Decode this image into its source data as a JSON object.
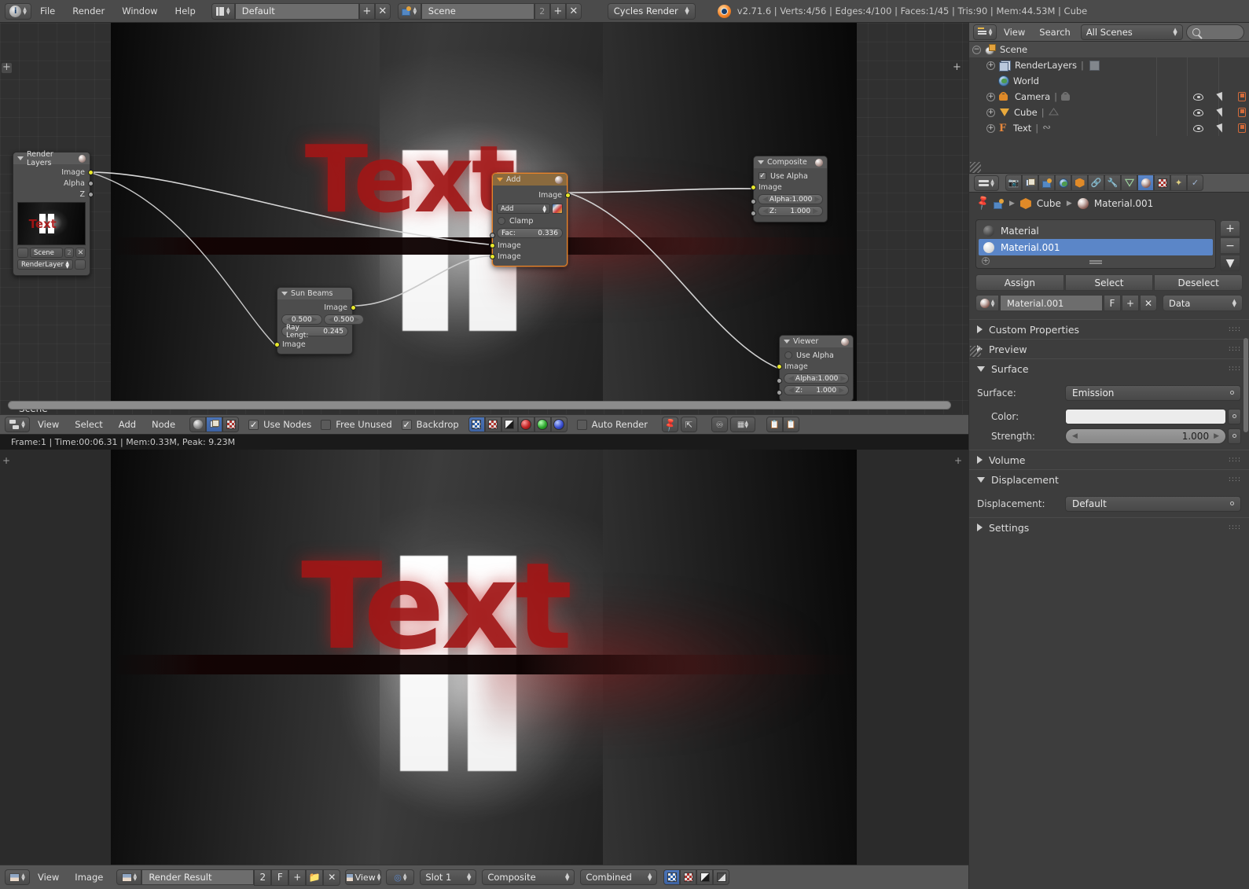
{
  "topbar": {
    "menus": [
      "File",
      "Render",
      "Window",
      "Help"
    ],
    "screen_layout": "Default",
    "scene_name": "Scene",
    "scene_users": "2",
    "engine": "Cycles Render",
    "version_info": "v2.71.6 | Verts:4/56 | Edges:4/100 | Faces:1/45 | Tris:90 | Mem:44.53M | Cube",
    "add_label": "+",
    "close_label": "✕"
  },
  "node_editor": {
    "scene_tag": "Scene",
    "header": {
      "menus": [
        "View",
        "Select",
        "Add",
        "Node"
      ],
      "use_nodes": "Use Nodes",
      "free_unused": "Free Unused",
      "backdrop": "Backdrop",
      "auto_render": "Auto Render"
    },
    "render_status": "Frame:1 | Time:00:06.31 | Mem:0.33M, Peak: 9.23M",
    "backdrop_text": "Text",
    "nodes": {
      "render_layers": {
        "title": "Render Layers",
        "outputs": [
          "Image",
          "Alpha",
          "Z"
        ],
        "scene_field": "Scene",
        "scene_users": "2",
        "layer_field": "RenderLayer",
        "preview_text": "Text"
      },
      "sun_beams": {
        "title": "Sun Beams",
        "output": "Image",
        "source_x": "0.500",
        "source_y": "0.500",
        "ray_length_label": "Ray Lengt:",
        "ray_length_value": "0.245",
        "input": "Image"
      },
      "add_mix": {
        "title": "Add",
        "output": "Image",
        "blend_mode": "Add",
        "clamp_label": "Clamp",
        "fac_label": "Fac:",
        "fac_value": "0.336",
        "input_1": "Image",
        "input_2": "Image"
      },
      "composite": {
        "title": "Composite",
        "use_alpha": "Use Alpha",
        "image": "Image",
        "alpha_label": "Alpha:",
        "alpha_value": "1.000",
        "z_label": "Z:",
        "z_value": "1.000"
      },
      "viewer": {
        "title": "Viewer",
        "use_alpha": "Use Alpha",
        "image": "Image",
        "alpha_label": "Alpha:",
        "alpha_value": "1.000",
        "z_label": "Z:",
        "z_value": "1.000"
      }
    }
  },
  "image_editor": {
    "menus": [
      "View",
      "Image"
    ],
    "image_name": "Render Result",
    "image_users": "2",
    "fake_user": "F",
    "view_menu": "View",
    "slot": "Slot 1",
    "pass_layer": "Composite",
    "pass_type": "Combined",
    "rendered_text": "Text"
  },
  "outliner": {
    "view_label": "View",
    "search_label": "Search",
    "display_mode": "All Scenes",
    "search_placeholder": "",
    "items": [
      {
        "label": "Scene",
        "icon": "scene-icon",
        "depth": 0
      },
      {
        "label": "RenderLayers",
        "icon": "render-layers-icon",
        "depth": 1
      },
      {
        "label": "World",
        "icon": "world-icon",
        "depth": 1
      },
      {
        "label": "Camera",
        "icon": "camera-icon",
        "depth": 1
      },
      {
        "label": "Cube",
        "icon": "mesh-icon",
        "depth": 1
      },
      {
        "label": "Text",
        "icon": "font-icon",
        "depth": 1
      }
    ]
  },
  "properties": {
    "breadcrumb": {
      "object": "Cube",
      "material": "Material.001"
    },
    "material_slots": [
      {
        "label": "Material",
        "selected": false
      },
      {
        "label": "Material.001",
        "selected": true
      }
    ],
    "assign_buttons": [
      "Assign",
      "Select",
      "Deselect"
    ],
    "material_name": "Material.001",
    "fake_user_btn": "F",
    "add_btn": "+",
    "unlink_btn": "✕",
    "data_dropdown": "Data",
    "panels": [
      {
        "title": "Custom Properties",
        "open": false
      },
      {
        "title": "Preview",
        "open": false
      },
      {
        "title": "Surface",
        "open": true
      },
      {
        "title": "Volume",
        "open": false
      },
      {
        "title": "Displacement",
        "open": true
      },
      {
        "title": "Settings",
        "open": false
      }
    ],
    "surface": {
      "surface_label": "Surface:",
      "surface_value": "Emission",
      "color_label": "Color:",
      "color_value": "#ececec",
      "strength_label": "Strength:",
      "strength_value": "1.000"
    },
    "displacement": {
      "label": "Displacement:",
      "value": "Default"
    },
    "side_buttons": [
      "+",
      "−",
      "▼"
    ]
  },
  "colors": {
    "accent_blue": "#5b86c8",
    "node_selected": "#e8842a",
    "socket_yellow": "#e8e82b",
    "panel_bg": "#3d3d3d",
    "header_bg": "#565656"
  }
}
